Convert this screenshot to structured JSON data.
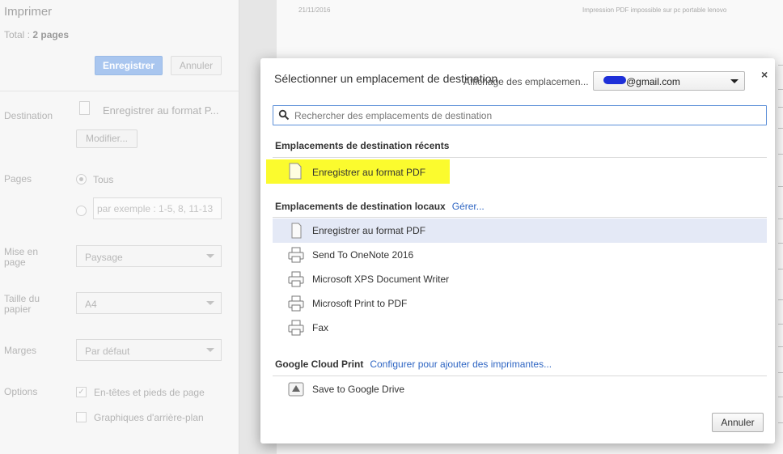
{
  "left_panel": {
    "title": "Imprimer",
    "total_label": "Total :",
    "total_value": "2 pages",
    "save_button": "Enregistrer",
    "cancel_button": "Annuler",
    "destination_label": "Destination",
    "destination_value": "Enregistrer au format P...",
    "modify_button": "Modifier...",
    "pages_label": "Pages",
    "pages_all": "Tous",
    "pages_placeholder": "par exemple : 1-5, 8, 11-13",
    "layout_label": "Mise en page",
    "layout_value": "Paysage",
    "paper_label": "Taille du papier",
    "paper_value": "A4",
    "margins_label": "Marges",
    "margins_value": "Par défaut",
    "options_label": "Options",
    "option_headers": "En-têtes et pieds de page",
    "option_background": "Graphiques d'arrière-plan"
  },
  "preview": {
    "date": "21/11/2016",
    "header": "Impression PDF impossible sur pc portable lenovo"
  },
  "dialog": {
    "title": "Sélectionner un emplacement de destination",
    "account_label": "Affichage des emplacemen...",
    "account_value": "@gmail.com",
    "close_icon": "×",
    "search_placeholder": "Rechercher des emplacements de destination",
    "recent_title": "Emplacements de destination récents",
    "recent_items": [
      "Enregistrer au format PDF"
    ],
    "local_title": "Emplacements de destination locaux",
    "local_manage": "Gérer...",
    "local_items": [
      {
        "label": "Enregistrer au format PDF",
        "icon": "document-icon"
      },
      {
        "label": "Send To OneNote 2016",
        "icon": "printer-icon"
      },
      {
        "label": "Microsoft XPS Document Writer",
        "icon": "printer-icon"
      },
      {
        "label": "Microsoft Print to PDF",
        "icon": "printer-icon"
      },
      {
        "label": "Fax",
        "icon": "printer-icon"
      }
    ],
    "cloud_title": "Google Cloud Print",
    "cloud_configure": "Configurer pour ajouter des imprimantes...",
    "cloud_items": [
      {
        "label": "Save to Google Drive",
        "icon": "google-drive-icon"
      }
    ],
    "cancel_button": "Annuler",
    "highlight_color": "#fbfb2e",
    "link_color": "#2f66c3",
    "selected_row_color": "#e4e9f6"
  }
}
